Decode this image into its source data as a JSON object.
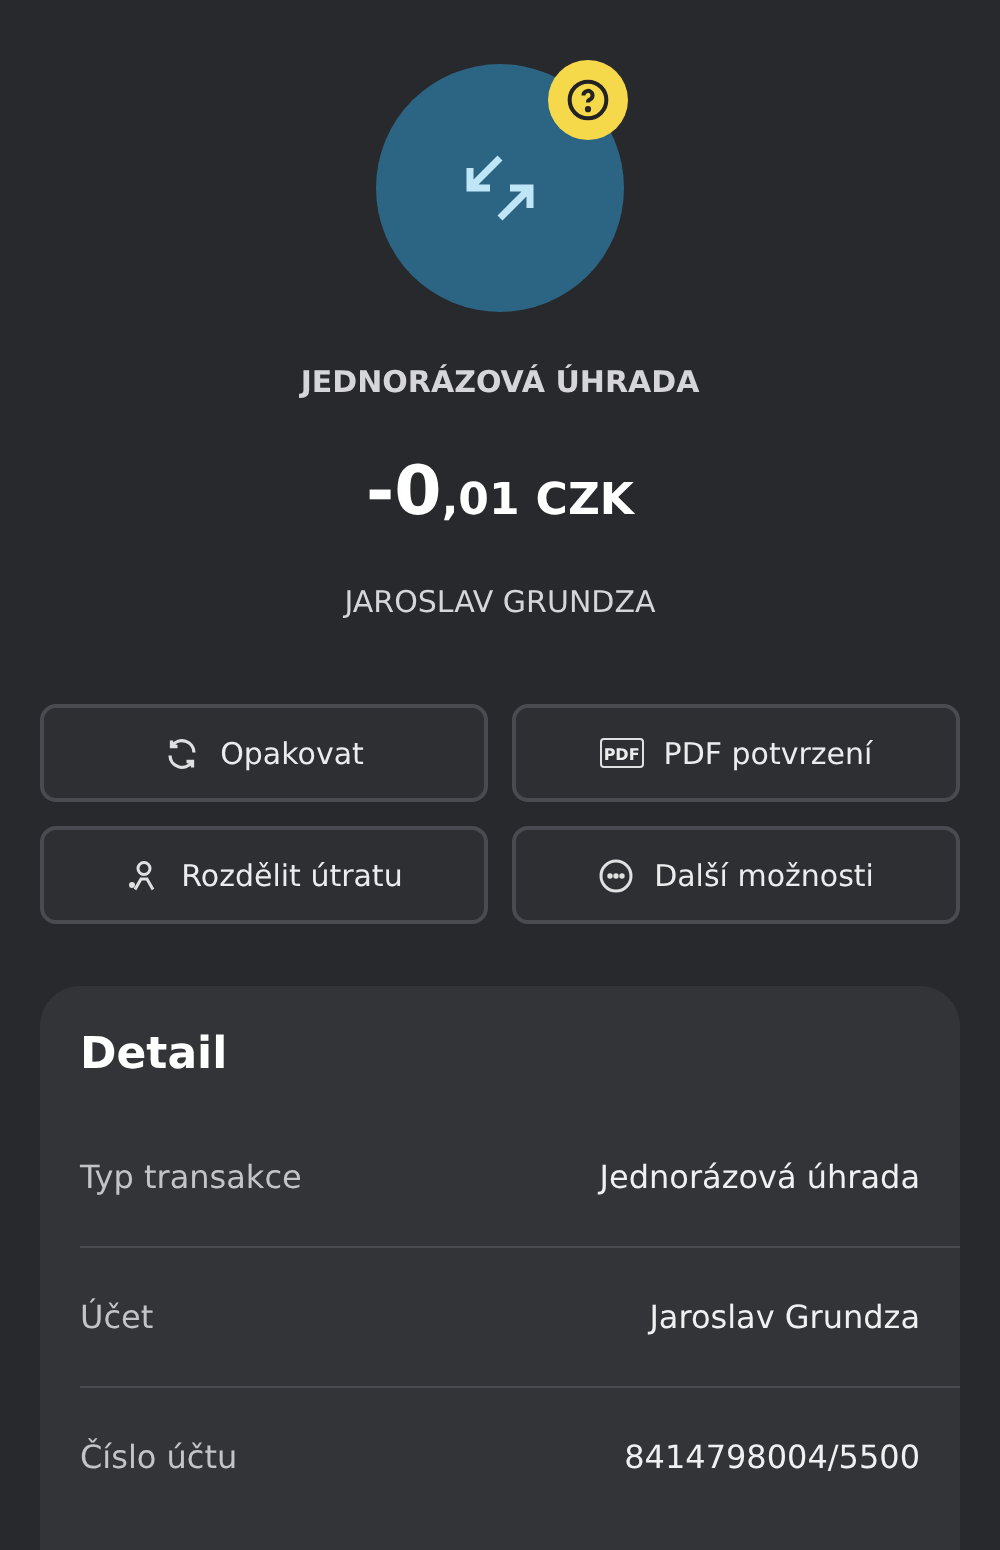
{
  "header": {
    "title": "JEDNORÁZOVÁ ÚHRADA",
    "amount": {
      "whole": "-0",
      "fraction": ",01",
      "currency": "CZK"
    },
    "counterparty": "JAROSLAV GRUNDZA"
  },
  "actions": [
    {
      "kind": "repeat",
      "label": "Opakovat"
    },
    {
      "kind": "pdf",
      "label": "PDF potvrzení",
      "icon_text": "PDF"
    },
    {
      "kind": "split",
      "label": "Rozdělit útratu"
    },
    {
      "kind": "more",
      "label": "Další možnosti"
    }
  ],
  "detail": {
    "title": "Detail",
    "rows": [
      {
        "label": "Typ transakce",
        "value": "Jednorázová úhrada"
      },
      {
        "label": "Účet",
        "value": "Jaroslav Grundza"
      },
      {
        "label": "Číslo účtu",
        "value": "8414798004/5500"
      }
    ]
  }
}
